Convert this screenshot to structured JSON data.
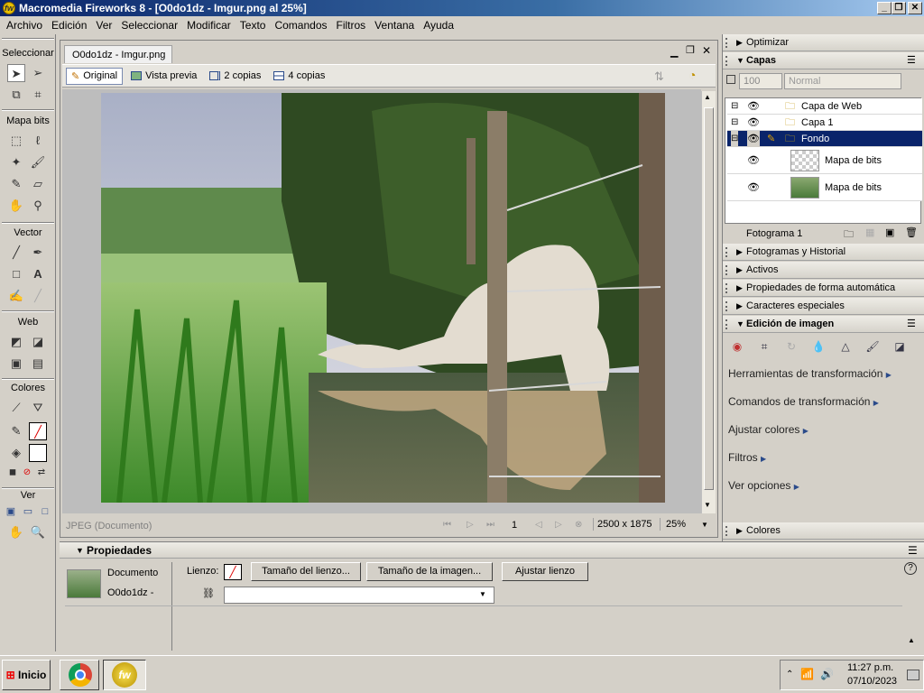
{
  "window": {
    "title": "Macromedia Fireworks 8 - [O0do1dz - Imgur.png al  25%]"
  },
  "menu": [
    "Archivo",
    "Edición",
    "Ver",
    "Seleccionar",
    "Modificar",
    "Texto",
    "Comandos",
    "Filtros",
    "Ventana",
    "Ayuda"
  ],
  "tools": {
    "sections": {
      "select": "Seleccionar",
      "bitmap": "Mapa bits",
      "vector": "Vector",
      "web": "Web",
      "colors": "Colores",
      "view": "Ver"
    }
  },
  "document": {
    "tab": "O0do1dz - Imgur.png",
    "views": [
      "Original",
      "Vista previa",
      "2 copias",
      "4 copias"
    ],
    "status_type": "JPEG (Documento)",
    "frame": "1",
    "size": "2500 x 1875",
    "zoom": "25%"
  },
  "panels": {
    "optimize": "Optimizar",
    "layers": {
      "title": "Capas",
      "opacity": "100",
      "blend": "Normal",
      "rows": [
        {
          "name": "Capa de Web"
        },
        {
          "name": "Capa 1"
        },
        {
          "name": "Fondo"
        },
        {
          "name": "Mapa de bits"
        },
        {
          "name": "Mapa de bits"
        }
      ],
      "frame_label": "Fotograma 1"
    },
    "frames_history": "Fotogramas y Historial",
    "assets": "Activos",
    "auto_shape": "Propiedades de forma automática",
    "special_chars": "Caracteres especiales",
    "image_edit": {
      "title": "Edición de imagen",
      "links": [
        "Herramientas de transformación",
        "Comandos de transformación",
        "Ajustar colores",
        "Filtros",
        "Ver opciones"
      ]
    },
    "colors": "Colores"
  },
  "properties": {
    "title": "Propiedades",
    "doc_label": "Documento",
    "doc_name": "O0do1dz -",
    "canvas_label": "Lienzo:",
    "canvas_size_btn": "Tamaño del lienzo...",
    "image_size_btn": "Tamaño de la imagen...",
    "fit_canvas_btn": "Ajustar lienzo",
    "help": "?"
  },
  "taskbar": {
    "start": "Inicio",
    "time": "11:27 p.m.",
    "date": "07/10/2023"
  },
  "colors": {
    "title_start": "#0a246a",
    "selection": "#0a246a"
  }
}
